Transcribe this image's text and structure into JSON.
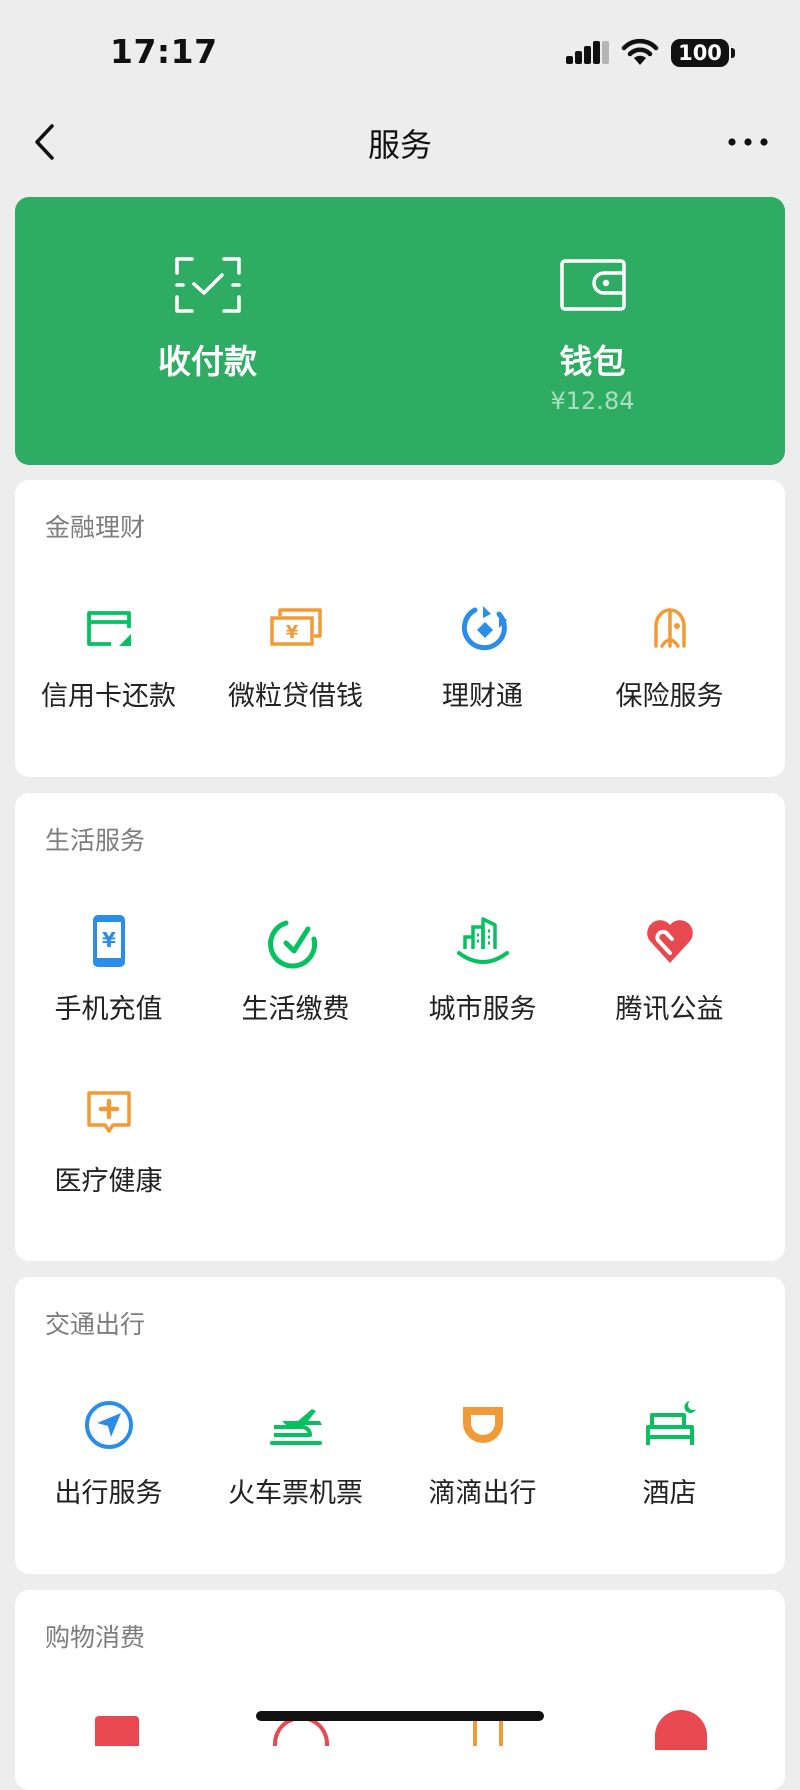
{
  "status_bar": {
    "time": "17:17",
    "battery": "100"
  },
  "header": {
    "title": "服务"
  },
  "wallet_card": {
    "pay_label": "收付款",
    "wallet_label": "钱包",
    "wallet_balance": "¥12.84"
  },
  "sections": [
    {
      "title": "金融理财",
      "items": [
        {
          "label": "信用卡还款",
          "icon": "credit-card-icon"
        },
        {
          "label": "微粒贷借钱",
          "icon": "loan-icon"
        },
        {
          "label": "理财通",
          "icon": "wealth-icon"
        },
        {
          "label": "保险服务",
          "icon": "insurance-icon"
        }
      ]
    },
    {
      "title": "生活服务",
      "items": [
        {
          "label": "手机充值",
          "icon": "phone-topup-icon"
        },
        {
          "label": "生活缴费",
          "icon": "utility-payment-icon"
        },
        {
          "label": "城市服务",
          "icon": "city-service-icon"
        },
        {
          "label": "腾讯公益",
          "icon": "charity-icon"
        },
        {
          "label": "医疗健康",
          "icon": "medical-icon"
        }
      ]
    },
    {
      "title": "交通出行",
      "items": [
        {
          "label": "出行服务",
          "icon": "travel-icon"
        },
        {
          "label": "火车票机票",
          "icon": "train-plane-icon"
        },
        {
          "label": "滴滴出行",
          "icon": "didi-icon"
        },
        {
          "label": "酒店",
          "icon": "hotel-icon"
        }
      ]
    },
    {
      "title": "购物消费",
      "items": []
    }
  ],
  "colors": {
    "green": "#2fac63",
    "icon_green": "#07c160",
    "icon_orange": "#f19b38",
    "icon_blue": "#2a8ee8",
    "icon_red": "#e8484f"
  }
}
